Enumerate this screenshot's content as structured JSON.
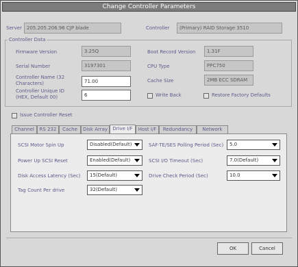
{
  "window": {
    "title": "Change Controller Parameters"
  },
  "server": {
    "label": "Server",
    "value": "205.205.206.96 CJP blade"
  },
  "controller": {
    "label": "Controller",
    "value": "(Primary) RAID Storage 3510"
  },
  "controller_data": {
    "group_title": "Controller Data",
    "firmware_version": {
      "label": "Firmware Version",
      "value": "3.25Q"
    },
    "boot_record_version": {
      "label": "Boot Record Version",
      "value": "1.31F"
    },
    "serial_number": {
      "label": "Serial Number",
      "value": "3197301"
    },
    "cpu_type": {
      "label": "CPU Type",
      "value": "PPC750"
    },
    "controller_name": {
      "label": "Controller Name (32 Characters)",
      "value": "71.00"
    },
    "cache_size": {
      "label": "Cache Size",
      "value": "2MB ECC SDRAM"
    },
    "controller_unique_id": {
      "label": "Controller Unique ID (HEX, Default 00)",
      "value": "6"
    },
    "write_back": {
      "label": "Write Back"
    },
    "restore_factory": {
      "label": "Restore Factory Defaults"
    }
  },
  "issue_reset": {
    "label": "Issue Controller Reset"
  },
  "tabs": [
    {
      "label": "Channel"
    },
    {
      "label": "RS 232"
    },
    {
      "label": "Cache"
    },
    {
      "label": "Disk Array"
    },
    {
      "label": "Drive I/F"
    },
    {
      "label": "Host I/F"
    },
    {
      "label": "Redundancy"
    },
    {
      "label": "Network"
    }
  ],
  "drive_if": {
    "spin_up": {
      "label": "SCSI Motor Spin Up",
      "value": "Disabled(Default)"
    },
    "power_up_reset": {
      "label": "Power Up SCSI Reset",
      "value": "Enabled(Default)"
    },
    "disk_access_latency": {
      "label": "Disk Access Latency (Sec)",
      "value": "15(Default)"
    },
    "tag_count": {
      "label": "Tag Count Per drive",
      "value": "32(Default)"
    },
    "periodic_check": {
      "label": "SAF-TE/SES Polling Period (Sec)",
      "value": "5.0"
    },
    "io_timeout": {
      "label": "SCSI I/O Timeout (Sec)",
      "value": "7.0(Default)"
    },
    "drive_check_period": {
      "label": "Drive Check Period (Sec)",
      "value": "10.0"
    }
  },
  "buttons": {
    "ok": "OK",
    "cancel": "Cancel"
  }
}
